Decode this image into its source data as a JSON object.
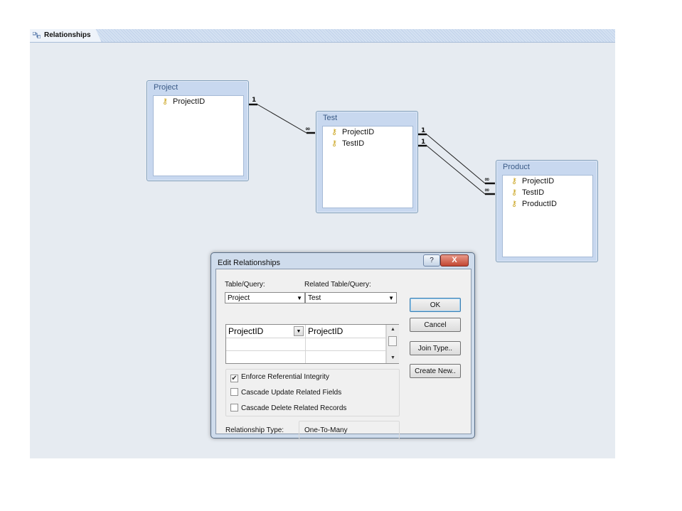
{
  "tab": {
    "label": "Relationships"
  },
  "tables": [
    {
      "title": "Project",
      "fields": [
        "ProjectID"
      ]
    },
    {
      "title": "Test",
      "fields": [
        "ProjectID",
        "TestID"
      ]
    },
    {
      "title": "Product",
      "fields": [
        "ProjectID",
        "TestID",
        "ProductID"
      ]
    }
  ],
  "lines": {
    "one": "1",
    "many": "∞"
  },
  "dialog": {
    "title": "Edit Relationships",
    "help": "?",
    "close": "X",
    "table_query_label": "Table/Query:",
    "related_label": "Related Table/Query:",
    "table_value": "Project",
    "related_value": "Test",
    "grid_rows": [
      {
        "left": "ProjectID",
        "right": "ProjectID"
      }
    ],
    "enforce_label": "Enforce Referential Integrity",
    "enforce_checked": true,
    "cascade_update_label": "Cascade Update Related Fields",
    "cascade_delete_label": "Cascade Delete Related Records",
    "rel_type_label": "Relationship Type:",
    "rel_type_value": "One-To-Many",
    "buttons": {
      "ok": "OK",
      "cancel": "Cancel",
      "join_type": "Join Type..",
      "create_new": "Create New.."
    }
  }
}
